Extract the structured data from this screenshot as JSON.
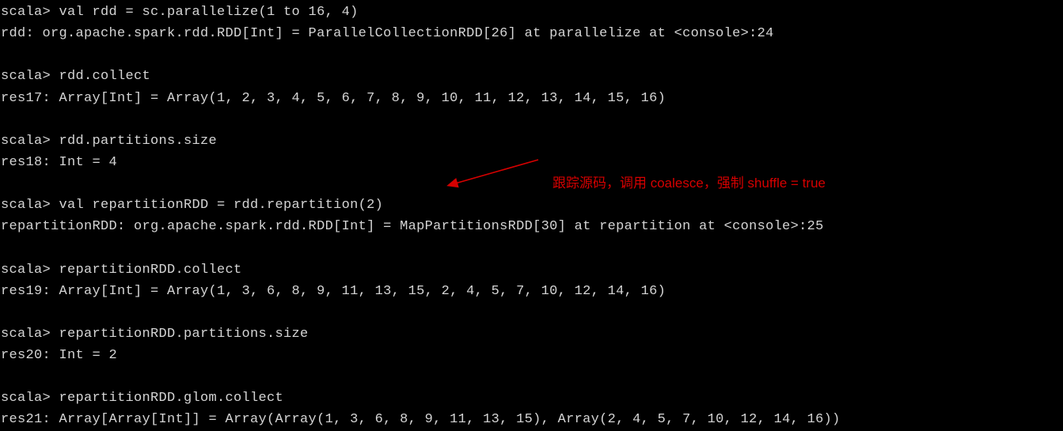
{
  "terminal": {
    "prompt": "scala> ",
    "lines": [
      {
        "type": "cmd",
        "text": "scala> val rdd = sc.parallelize(1 to 16, 4)"
      },
      {
        "type": "out",
        "text": "rdd: org.apache.spark.rdd.RDD[Int] = ParallelCollectionRDD[26] at parallelize at <console>:24"
      },
      {
        "type": "blank",
        "text": ""
      },
      {
        "type": "cmd",
        "text": "scala> rdd.collect"
      },
      {
        "type": "out",
        "text": "res17: Array[Int] = Array(1, 2, 3, 4, 5, 6, 7, 8, 9, 10, 11, 12, 13, 14, 15, 16)"
      },
      {
        "type": "blank",
        "text": ""
      },
      {
        "type": "cmd",
        "text": "scala> rdd.partitions.size"
      },
      {
        "type": "out",
        "text": "res18: Int = 4"
      },
      {
        "type": "blank",
        "text": ""
      },
      {
        "type": "cmd",
        "text": "scala> val repartitionRDD = rdd.repartition(2)"
      },
      {
        "type": "out",
        "text": "repartitionRDD: org.apache.spark.rdd.RDD[Int] = MapPartitionsRDD[30] at repartition at <console>:25"
      },
      {
        "type": "blank",
        "text": ""
      },
      {
        "type": "cmd",
        "text": "scala> repartitionRDD.collect"
      },
      {
        "type": "out",
        "text": "res19: Array[Int] = Array(1, 3, 6, 8, 9, 11, 13, 15, 2, 4, 5, 7, 10, 12, 14, 16)"
      },
      {
        "type": "blank",
        "text": ""
      },
      {
        "type": "cmd",
        "text": "scala> repartitionRDD.partitions.size"
      },
      {
        "type": "out",
        "text": "res20: Int = 2"
      },
      {
        "type": "blank",
        "text": ""
      },
      {
        "type": "cmd",
        "text": "scala> repartitionRDD.glom.collect"
      },
      {
        "type": "out",
        "text": "res21: Array[Array[Int]] = Array(Array(1, 3, 6, 8, 9, 11, 13, 15), Array(2, 4, 5, 7, 10, 12, 14, 16))"
      }
    ]
  },
  "annotation": {
    "text": "跟踪源码，调用 coalesce，强制 shuffle = true"
  }
}
